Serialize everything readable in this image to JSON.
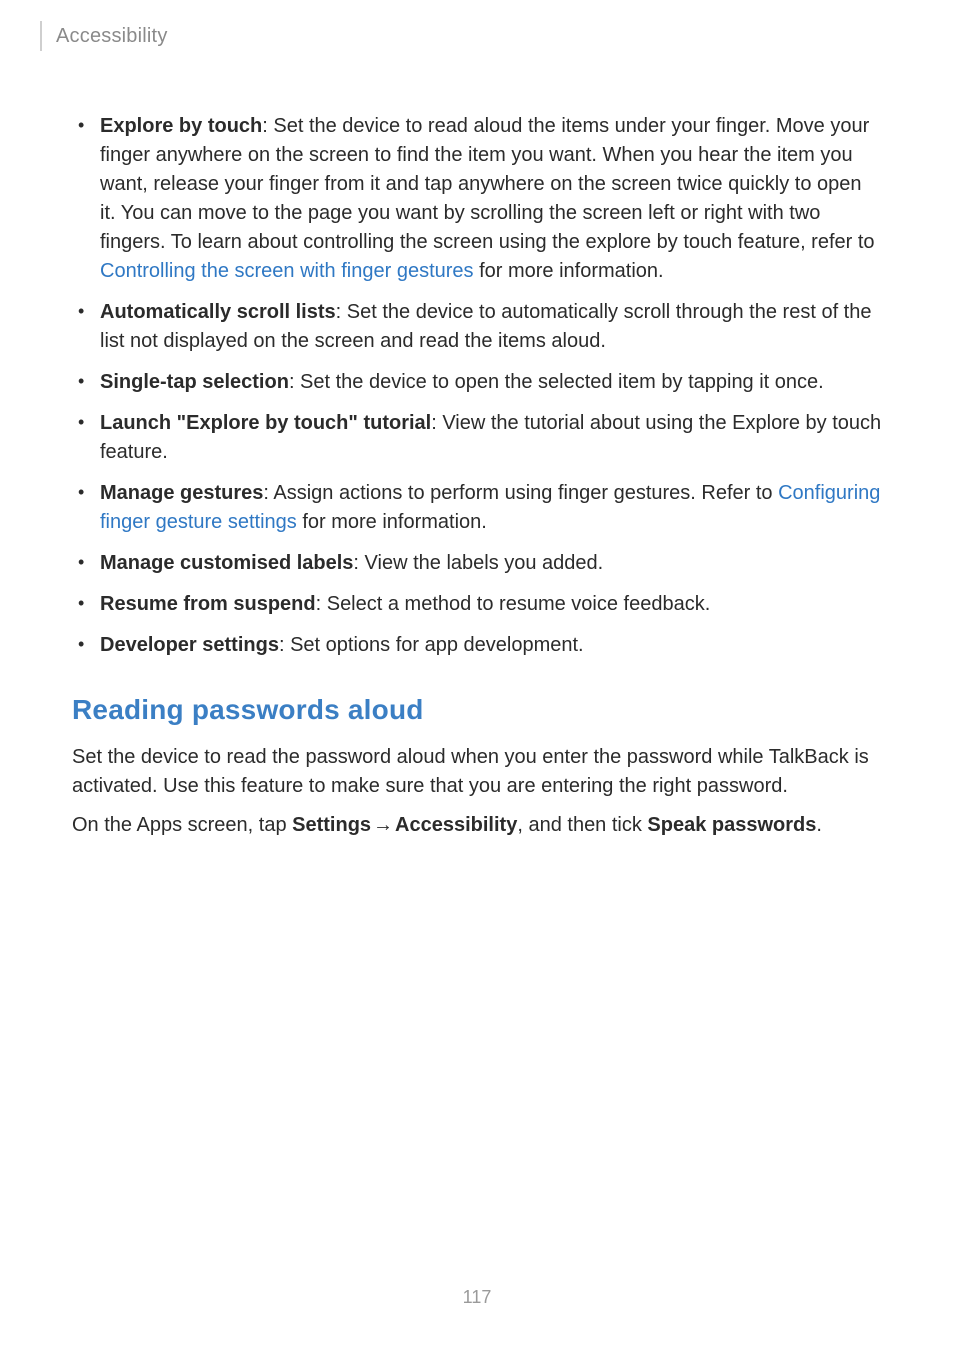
{
  "breadcrumb": "Accessibility",
  "page_number": "117",
  "bullets": [
    {
      "term": "Explore by touch",
      "pre": ": Set the device to read aloud the items under your finger. Move your finger anywhere on the screen to find the item you want. When you hear the item you want, release your finger from it and tap anywhere on the screen twice quickly to open it. You can move to the page you want by scrolling the screen left or right with two fingers. To learn about controlling the screen using the explore by touch feature, refer to ",
      "link": "Controlling the screen with finger gestures",
      "post": " for more information."
    },
    {
      "term": "Automatically scroll lists",
      "pre": ": Set the device to automatically scroll through the rest of the list not displayed on the screen and read the items aloud.",
      "link": "",
      "post": ""
    },
    {
      "term": "Single-tap selection",
      "pre": ": Set the device to open the selected item by tapping it once.",
      "link": "",
      "post": ""
    },
    {
      "term": "Launch \"Explore by touch\" tutorial",
      "pre": ": View the tutorial about using the Explore by touch feature.",
      "link": "",
      "post": ""
    },
    {
      "term": "Manage gestures",
      "pre": ": Assign actions to perform using finger gestures. Refer to ",
      "link": "Configuring finger gesture settings",
      "post": " for more information."
    },
    {
      "term": "Manage customised labels",
      "pre": ": View the labels you added.",
      "link": "",
      "post": ""
    },
    {
      "term": "Resume from suspend",
      "pre": ": Select a method to resume voice feedback.",
      "link": "",
      "post": ""
    },
    {
      "term": "Developer settings",
      "pre": ": Set options for app development.",
      "link": "",
      "post": ""
    }
  ],
  "section": {
    "heading": "Reading passwords aloud",
    "p1": "Set the device to read the password aloud when you enter the password while TalkBack is activated. Use this feature to make sure that you are entering the right password.",
    "p2_a": "On the Apps screen, tap ",
    "p2_b": "Settings",
    "p2_arrow": " → ",
    "p2_c": "Accessibility",
    "p2_d": ", and then tick ",
    "p2_e": "Speak passwords",
    "p2_f": "."
  }
}
